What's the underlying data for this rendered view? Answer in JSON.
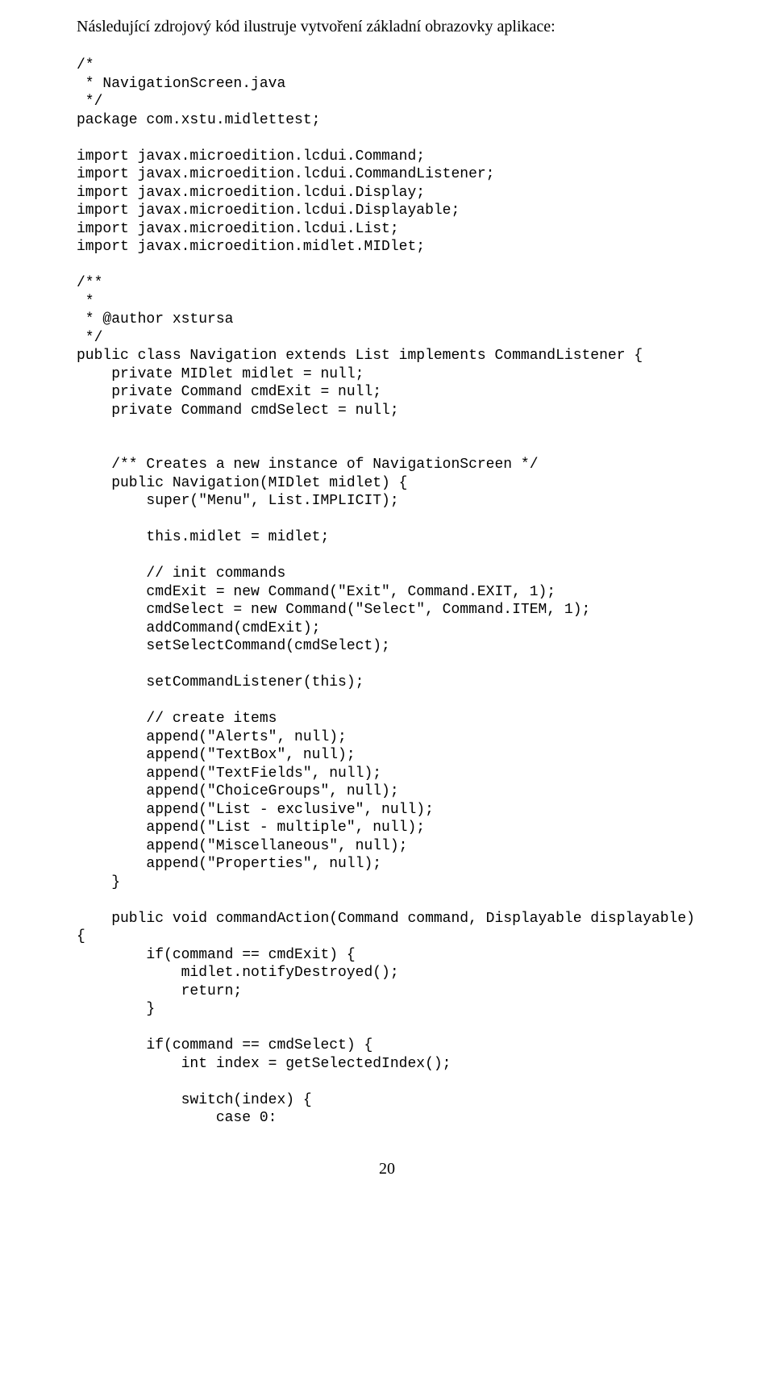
{
  "intro": "Následující zdrojový kód ilustruje vytvoření základní obrazovky aplikace:",
  "code": "/*\n * NavigationScreen.java\n */\npackage com.xstu.midlettest;\n\nimport javax.microedition.lcdui.Command;\nimport javax.microedition.lcdui.CommandListener;\nimport javax.microedition.lcdui.Display;\nimport javax.microedition.lcdui.Displayable;\nimport javax.microedition.lcdui.List;\nimport javax.microedition.midlet.MIDlet;\n\n/**\n *\n * @author xstursa\n */\npublic class Navigation extends List implements CommandListener {\n    private MIDlet midlet = null;\n    private Command cmdExit = null;\n    private Command cmdSelect = null;\n\n\n    /** Creates a new instance of NavigationScreen */\n    public Navigation(MIDlet midlet) {\n        super(\"Menu\", List.IMPLICIT);\n\n        this.midlet = midlet;\n\n        // init commands\n        cmdExit = new Command(\"Exit\", Command.EXIT, 1);\n        cmdSelect = new Command(\"Select\", Command.ITEM, 1);\n        addCommand(cmdExit);\n        setSelectCommand(cmdSelect);\n\n        setCommandListener(this);\n\n        // create items\n        append(\"Alerts\", null);\n        append(\"TextBox\", null);\n        append(\"TextFields\", null);\n        append(\"ChoiceGroups\", null);\n        append(\"List - exclusive\", null);\n        append(\"List - multiple\", null);\n        append(\"Miscellaneous\", null);\n        append(\"Properties\", null);\n    }\n\n    public void commandAction(Command command, Displayable displayable)\n{\n        if(command == cmdExit) {\n            midlet.notifyDestroyed();\n            return;\n        }\n\n        if(command == cmdSelect) {\n            int index = getSelectedIndex();\n\n            switch(index) {\n                case 0:",
  "page_number": "20"
}
